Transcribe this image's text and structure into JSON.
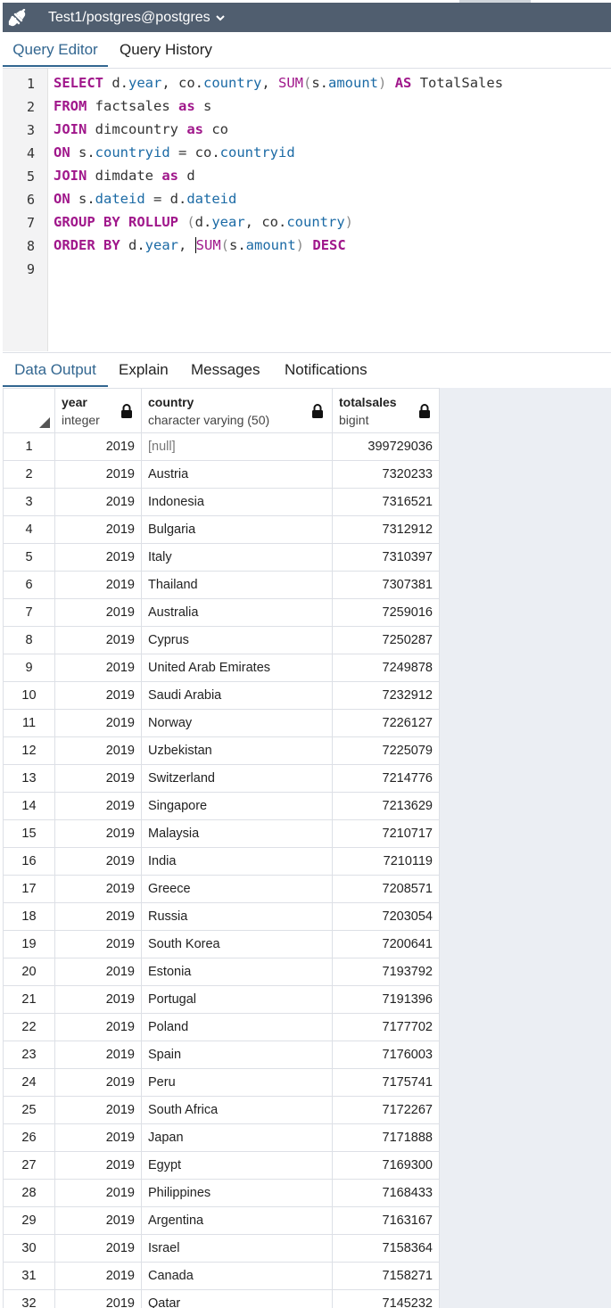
{
  "connection": {
    "title": "Test1/postgres@postgres",
    "icon": "connection-icon",
    "dropdown_icon": "chevron-down-icon"
  },
  "editor_tabs": [
    {
      "label": "Query Editor",
      "active": true
    },
    {
      "label": "Query History",
      "active": false
    }
  ],
  "query": {
    "line_numbers": [
      "1",
      "2",
      "3",
      "4",
      "5",
      "6",
      "7",
      "8",
      "9"
    ]
  },
  "output_tabs": [
    {
      "label": "Data Output",
      "active": true
    },
    {
      "label": "Explain",
      "active": false
    },
    {
      "label": "Messages",
      "active": false
    },
    {
      "label": "Notifications",
      "active": false
    }
  ],
  "columns": [
    {
      "name": "year",
      "type": "integer"
    },
    {
      "name": "country",
      "type": "character varying (50)"
    },
    {
      "name": "totalsales",
      "type": "bigint"
    }
  ],
  "rows": [
    [
      "1",
      "2019",
      "[null]",
      "399729036"
    ],
    [
      "2",
      "2019",
      "Austria",
      "7320233"
    ],
    [
      "3",
      "2019",
      "Indonesia",
      "7316521"
    ],
    [
      "4",
      "2019",
      "Bulgaria",
      "7312912"
    ],
    [
      "5",
      "2019",
      "Italy",
      "7310397"
    ],
    [
      "6",
      "2019",
      "Thailand",
      "7307381"
    ],
    [
      "7",
      "2019",
      "Australia",
      "7259016"
    ],
    [
      "8",
      "2019",
      "Cyprus",
      "7250287"
    ],
    [
      "9",
      "2019",
      "United Arab Emirates",
      "7249878"
    ],
    [
      "10",
      "2019",
      "Saudi Arabia",
      "7232912"
    ],
    [
      "11",
      "2019",
      "Norway",
      "7226127"
    ],
    [
      "12",
      "2019",
      "Uzbekistan",
      "7225079"
    ],
    [
      "13",
      "2019",
      "Switzerland",
      "7214776"
    ],
    [
      "14",
      "2019",
      "Singapore",
      "7213629"
    ],
    [
      "15",
      "2019",
      "Malaysia",
      "7210717"
    ],
    [
      "16",
      "2019",
      "India",
      "7210119"
    ],
    [
      "17",
      "2019",
      "Greece",
      "7208571"
    ],
    [
      "18",
      "2019",
      "Russia",
      "7203054"
    ],
    [
      "19",
      "2019",
      "South Korea",
      "7200641"
    ],
    [
      "20",
      "2019",
      "Estonia",
      "7193792"
    ],
    [
      "21",
      "2019",
      "Portugal",
      "7191396"
    ],
    [
      "22",
      "2019",
      "Poland",
      "7177702"
    ],
    [
      "23",
      "2019",
      "Spain",
      "7176003"
    ],
    [
      "24",
      "2019",
      "Peru",
      "7175741"
    ],
    [
      "25",
      "2019",
      "South Africa",
      "7172267"
    ],
    [
      "26",
      "2019",
      "Japan",
      "7171888"
    ],
    [
      "27",
      "2019",
      "Egypt",
      "7169300"
    ],
    [
      "28",
      "2019",
      "Philippines",
      "7168433"
    ],
    [
      "29",
      "2019",
      "Argentina",
      "7163167"
    ],
    [
      "30",
      "2019",
      "Israel",
      "7158364"
    ],
    [
      "31",
      "2019",
      "Canada",
      "7158271"
    ],
    [
      "32",
      "2019",
      "Qatar",
      "7145232"
    ]
  ],
  "colors": {
    "header_bar": "#505e6f",
    "accent": "#326690",
    "keyword": "#a0178b",
    "identifier": "#1b6aa5"
  }
}
